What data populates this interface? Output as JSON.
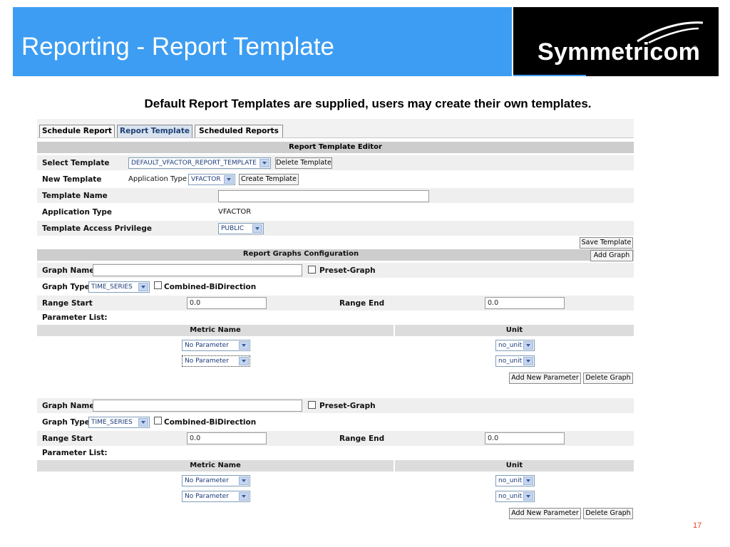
{
  "slide": {
    "title": "Reporting - Report Template",
    "logo": "Symmetricom",
    "logo_mark": "®",
    "subtitle": "Default Report Templates are supplied, users may create their own templates.",
    "page_number": "17"
  },
  "tabs": [
    "Schedule Report",
    "Report Template",
    "Scheduled Reports"
  ],
  "active_tab": "Report Template",
  "editor": {
    "header": "Report Template Editor",
    "select_template_label": "Select Template",
    "select_template_value": "DEFAULT_VFACTOR_REPORT_TEMPLATE",
    "delete_template_button": "Delete Template",
    "new_template_label": "New Template",
    "application_type_inline_label": "Application Type",
    "application_type_select": "VFACTOR",
    "create_template_button": "Create Template",
    "template_name_label": "Template Name",
    "template_name_value": "",
    "application_type_label": "Application Type",
    "application_type_value": "VFACTOR",
    "access_privilege_label": "Template Access Privilege",
    "access_privilege_value": "PUBLIC",
    "save_template_button": "Save Template"
  },
  "graphs_config": {
    "header": "Report Graphs Configuration",
    "add_graph_button": "Add Graph",
    "graphs": [
      {
        "graph_name_label": "Graph Name",
        "graph_name_value": "",
        "preset_graph_label": "Preset-Graph",
        "graph_type_label": "Graph Type",
        "graph_type_value": "TIME_SERIES",
        "combined_label": "Combined-BiDirection",
        "range_start_label": "Range Start",
        "range_start_value": "0.0",
        "range_end_label": "Range End",
        "range_end_value": "0.0",
        "parameter_list_label": "Parameter List:",
        "metric_name_header": "Metric Name",
        "unit_header": "Unit",
        "parameters": [
          {
            "metric": "No Parameter",
            "unit": "no_unit"
          },
          {
            "metric": "No Parameter",
            "unit": "no_unit"
          }
        ],
        "add_parameter_button": "Add New Parameter",
        "delete_graph_button": "Delete Graph"
      },
      {
        "graph_name_label": "Graph Name",
        "graph_name_value": "",
        "preset_graph_label": "Preset-Graph",
        "graph_type_label": "Graph Type",
        "graph_type_value": "TIME_SERIES",
        "combined_label": "Combined-BiDirection",
        "range_start_label": "Range Start",
        "range_start_value": "0.0",
        "range_end_label": "Range End",
        "range_end_value": "0.0",
        "parameter_list_label": "Parameter List:",
        "metric_name_header": "Metric Name",
        "unit_header": "Unit",
        "parameters": [
          {
            "metric": "No Parameter",
            "unit": "no_unit"
          },
          {
            "metric": "No Parameter",
            "unit": "no_unit"
          }
        ],
        "add_parameter_button": "Add New Parameter",
        "delete_graph_button": "Delete Graph"
      }
    ]
  },
  "colors": {
    "banner": "#3d9df2",
    "logo_bg": "#000000",
    "active_tab": "#d9e3f0",
    "header_bar": "#cdcdcd",
    "page_number": "#e8401c"
  },
  "icons": [
    "dropdown-arrow-icon",
    "checkbox-icon",
    "logo-swoosh-icon"
  ]
}
